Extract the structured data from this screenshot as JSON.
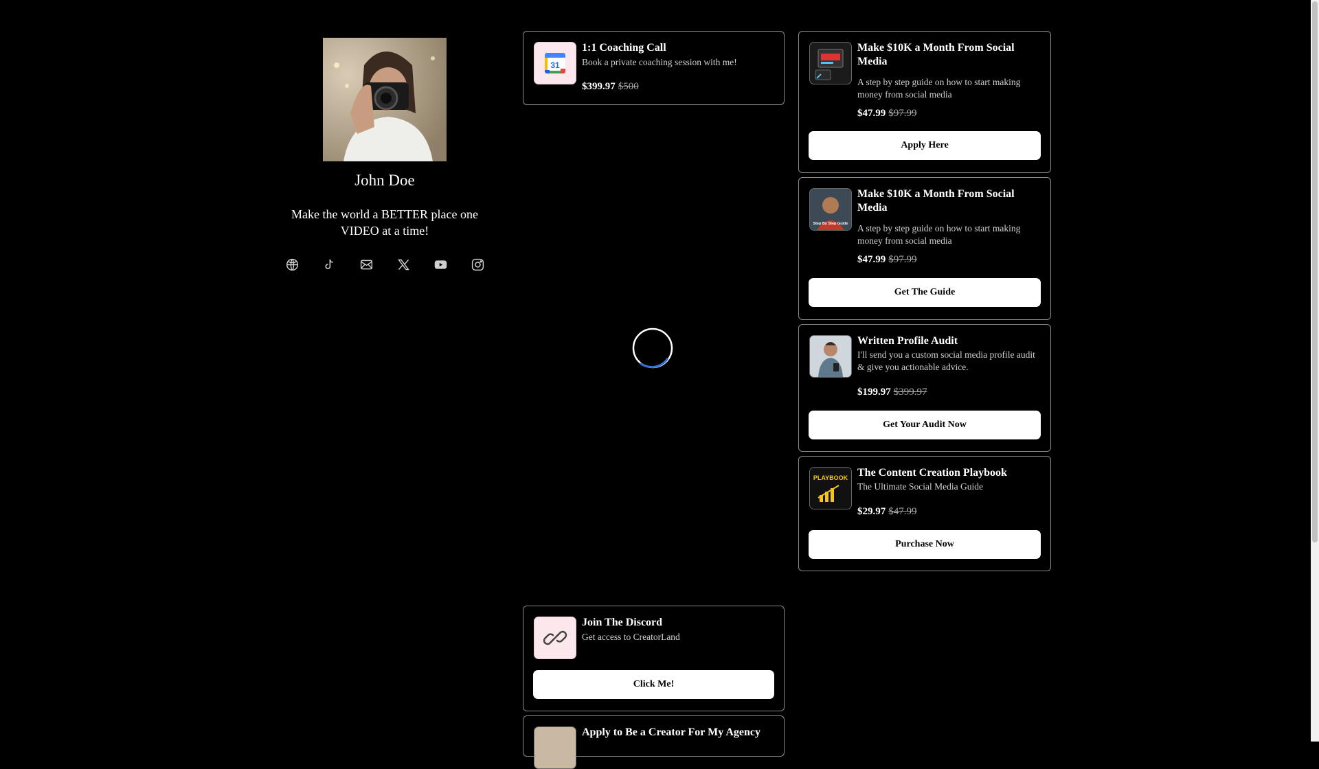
{
  "profile": {
    "name": "John Doe",
    "bio": "Make the world a BETTER place one VIDEO at a time!",
    "socials": [
      "web-icon",
      "tiktok-icon",
      "email-icon",
      "x-icon",
      "youtube-icon",
      "instagram-icon"
    ]
  },
  "cards_left": [
    {
      "title": "1:1 Coaching Call",
      "desc": "Book a private coaching session with me!",
      "price": "$399.97",
      "old_price": "$500"
    },
    {
      "title": "Join The Discord",
      "desc": "Get access to CreatorLand",
      "cta": "Click Me!"
    },
    {
      "title": "Apply to Be a Creator For My Agency"
    }
  ],
  "cards_right": [
    {
      "title": "Make $10K a Month From Social Media",
      "desc": "A step by step guide on how to start making money from social media",
      "price": "$47.99",
      "old_price": "$97.99",
      "cta": "Apply Here"
    },
    {
      "title": "Make $10K a Month From Social Media",
      "desc": "A step by step guide on how to start making money from social media",
      "price": "$47.99",
      "old_price": "$97.99",
      "cta": "Get The Guide",
      "thumb_text": "Step By Step Guide"
    },
    {
      "title": "Written Profile Audit",
      "desc": "I'll send you a custom social media profile audit & give you actionable advice.",
      "price": "$199.97",
      "old_price": "$399.97",
      "cta": "Get Your Audit Now"
    },
    {
      "title": "The Content Creation Playbook",
      "desc": "The Ultimate Social Media Guide",
      "price": "$29.97",
      "old_price": "$47.99",
      "cta": "Purchase Now",
      "thumb_text": "PLAYBOOK"
    }
  ],
  "calendar_day": "31",
  "colors": {
    "background": "#000000",
    "card_border": "#8a8a8a",
    "button_bg": "#ffffff",
    "spinner": "#3b6fd8"
  }
}
